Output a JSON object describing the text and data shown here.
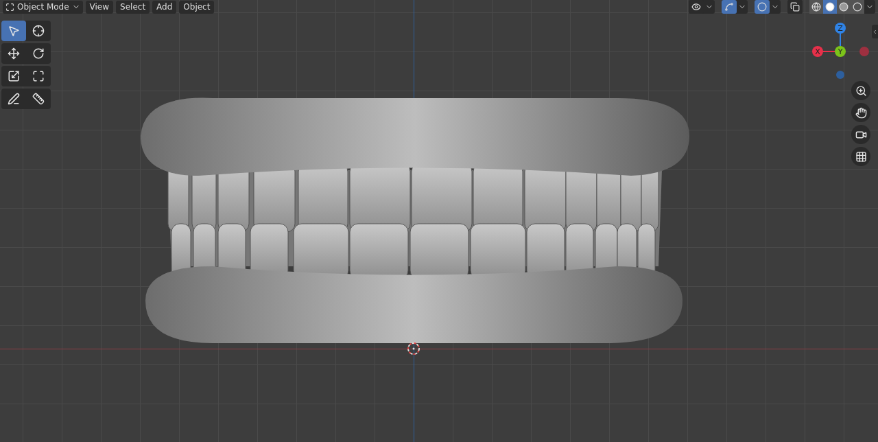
{
  "header": {
    "mode": {
      "label": "Object Mode"
    },
    "menus": [
      "View",
      "Select",
      "Add",
      "Object"
    ],
    "toggles": [
      {
        "kind": "visibility",
        "on": false
      },
      {
        "kind": "gizmo",
        "on": true
      },
      {
        "kind": "overlay",
        "on": true
      },
      {
        "kind": "xray",
        "on": false
      }
    ],
    "shading": [
      {
        "kind": "wireframe",
        "selected": false
      },
      {
        "kind": "solid",
        "selected": true
      },
      {
        "kind": "material",
        "selected": false
      },
      {
        "kind": "rendered",
        "selected": false
      }
    ]
  },
  "toolbar": [
    [
      {
        "kind": "select",
        "selected": true
      },
      {
        "kind": "cursor",
        "selected": false
      }
    ],
    [
      {
        "kind": "move",
        "selected": false
      },
      {
        "kind": "rotate",
        "selected": false
      }
    ],
    [
      {
        "kind": "scale",
        "selected": false
      },
      {
        "kind": "transform",
        "selected": false
      }
    ],
    [
      {
        "kind": "annotate",
        "selected": false
      },
      {
        "kind": "measure",
        "selected": false
      }
    ]
  ],
  "gizmo": {
    "axes": [
      {
        "label": "Z",
        "color": "#2f83e6"
      },
      {
        "label": "X",
        "color": "#e8304a"
      },
      {
        "label": "Y",
        "color": "#7cc41a"
      }
    ]
  },
  "navigation": [
    {
      "kind": "zoom"
    },
    {
      "kind": "pan"
    },
    {
      "kind": "camera"
    },
    {
      "kind": "ortho"
    }
  ]
}
